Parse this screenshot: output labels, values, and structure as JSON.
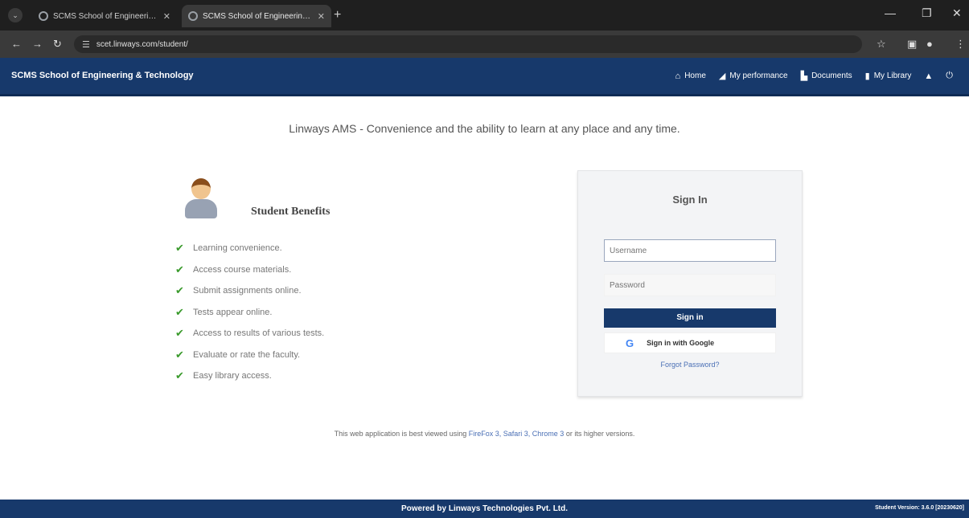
{
  "browser": {
    "tabs": [
      {
        "title": "SCMS School of Engineering & T"
      },
      {
        "title": "SCMS School of Engineering & T"
      }
    ],
    "url": "scet.linways.com/student/"
  },
  "header": {
    "brand": "SCMS School of Engineering & Technology",
    "nav": [
      {
        "label": "Home",
        "icon": "home-icon"
      },
      {
        "label": "My performance",
        "icon": "chart-icon"
      },
      {
        "label": "Documents",
        "icon": "document-icon"
      },
      {
        "label": "My Library",
        "icon": "book-icon"
      }
    ]
  },
  "main": {
    "tagline": "Linways AMS - Convenience and the ability to learn at any place and any time.",
    "benefits": {
      "title": "Student Benefits",
      "items": [
        "Learning convenience.",
        "Access course materials.",
        "Submit assignments online.",
        "Tests appear online.",
        "Access to results of various tests.",
        "Evaluate or rate the faculty.",
        "Easy library access."
      ]
    },
    "signin": {
      "title": "Sign In",
      "username_placeholder": "Username",
      "password_placeholder": "Password",
      "signin_button": "Sign in",
      "google_button": "Sign in with Google",
      "forgot": "Forgot Password?"
    },
    "compat": {
      "prefix": "This web application is best viewed using",
      "versions": "FireFox 3, Safari 3, Chrome 3",
      "suffix": "or its higher versions."
    }
  },
  "footer": {
    "powered": "Powered by Linways Technologies Pvt. Ltd.",
    "version": "Student Version: 3.6.0 [20230620]"
  },
  "colors": {
    "brand": "#17396b",
    "check": "#3a9a2c",
    "link": "#4a6fb5"
  }
}
